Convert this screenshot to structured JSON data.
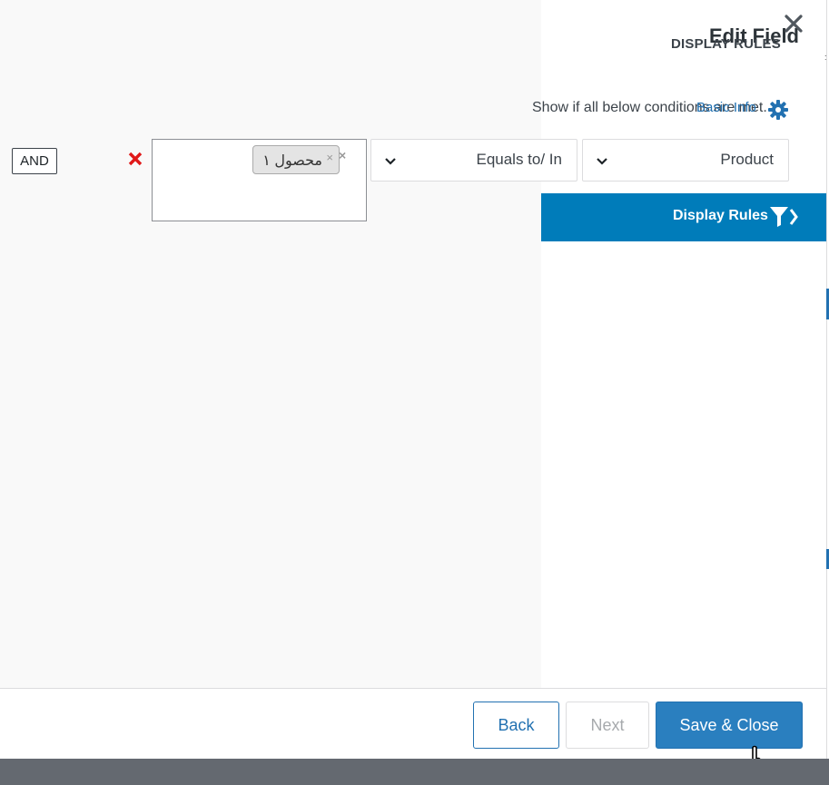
{
  "modal": {
    "title": "Edit Field",
    "section_heading": "DISPLAY RULES"
  },
  "tabs": {
    "basic_info": "Basic Info"
  },
  "rules": {
    "note": "Show if all below conditions are met.",
    "field_select": "Product",
    "operator_select": "Equals to/ In",
    "selected_values": [
      {
        "label": "محصول ۱"
      }
    ],
    "logic_button": "AND"
  },
  "sidebar": {
    "display_rules_label": "Display Rules"
  },
  "footer": {
    "back_label": "Back",
    "next_label": "Next",
    "save_close_label": "Save & Close"
  },
  "colors": {
    "accent": "#007cba",
    "save_button": "#2a7fbf",
    "remove": "#e01919"
  }
}
